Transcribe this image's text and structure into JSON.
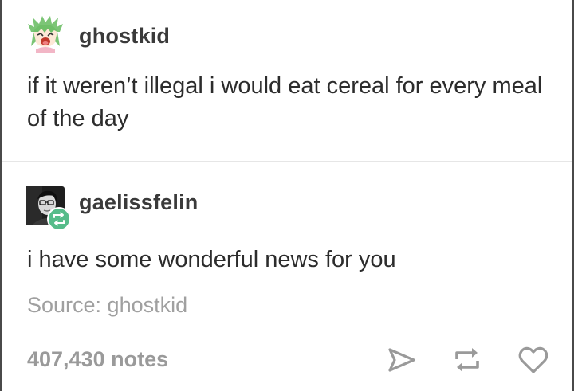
{
  "original_post": {
    "username": "ghostkid",
    "text": "if it weren’t illegal i would eat cereal for every meal of the day",
    "avatar_icon": "anime-girl-avatar-icon"
  },
  "reblog": {
    "username": "gaelissfelin",
    "text": "i have some wonderful news for you",
    "avatar_icon": "person-photo-avatar-icon",
    "badge_icon": "reblog-badge-icon",
    "source_label": "Source: ghostkid"
  },
  "footer": {
    "notes": "407,430 notes",
    "actions": [
      "share",
      "reblog",
      "like"
    ]
  },
  "colors": {
    "reblog_badge": "#56bc8a",
    "username": "#3a3a3a",
    "muted": "#9a9a9a"
  }
}
